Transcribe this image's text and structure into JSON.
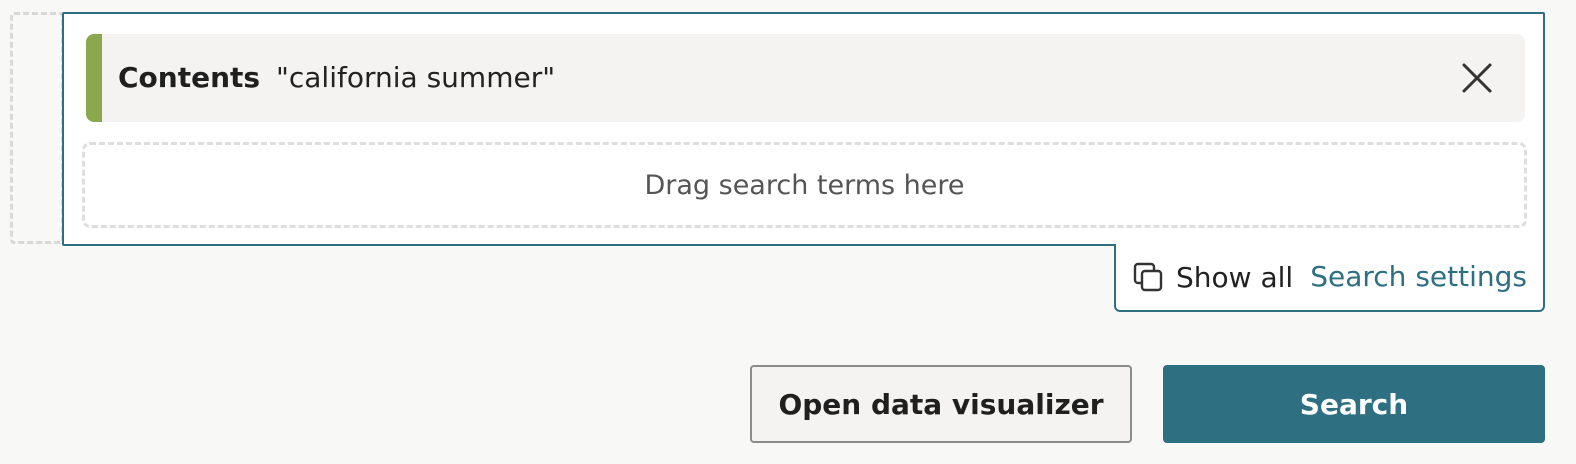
{
  "query": {
    "term": {
      "field": "Contents",
      "value": "\"california summer\"",
      "remove_icon": "close-icon",
      "accent_color": "#8aa84c"
    },
    "drop_zone_text": "Drag search terms here"
  },
  "options": {
    "show_all_icon": "copy-icon",
    "show_all_label": "Show all",
    "settings_link": "Search settings"
  },
  "actions": {
    "visualizer_label": "Open data visualizer",
    "search_label": "Search"
  },
  "colors": {
    "primary": "#2e6f82",
    "accent": "#8aa84c",
    "background": "#f8f8f6"
  }
}
